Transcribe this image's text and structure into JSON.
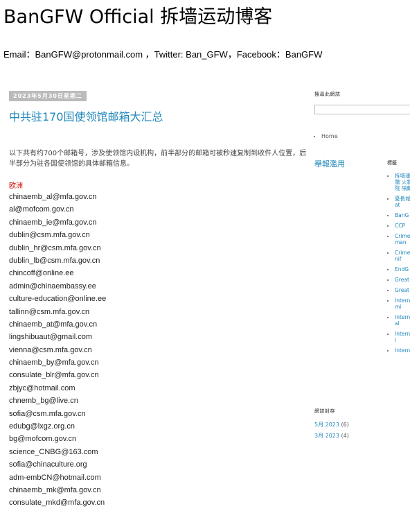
{
  "blog": {
    "title": "BanGFW Official 拆墙运动博客",
    "contact": "Email：BanGFW@protonmail.com ，Twitter: Ban_GFW，Facebook：BanGFW"
  },
  "post": {
    "date": "2023年5月30日星期二",
    "title": "中共驻170国使领馆邮箱大汇总",
    "intro": "以下共有约700个邮箱号，涉及使领馆内设机构，前半部分的邮箱可被秒速复制到收件人位置，后半部分为驻各国使领馆的具体邮箱信息。",
    "region": "欧洲",
    "emails": [
      "chinaemb_al@mfa.gov.cn",
      "al@mofcom.gov.cn",
      "chinaemb_ie@mfa.gov.cn",
      "dublin@csm.mfa.gov.cn",
      "dublin_hr@csm.mfa.gov.cn",
      "dublin_lb@csm.mfa.gov.cn",
      "chincoff@online.ee",
      "admin@chinaembassy.ee",
      "culture-education@online.ee",
      "tallinn@csm.mfa.gov.cn",
      "chinaemb_at@mfa.gov.cn",
      "lingshibuaut@gmail.com",
      "vienna@csm.mfa.gov.cn",
      "chinaemb_by@mfa.gov.cn",
      "consulate_blr@mfa.gov.cn",
      "zbjyc@hotmail.com",
      "chnemb_bg@live.cn",
      "sofia@csm.mfa.gov.cn",
      "edubg@lxgz.org.cn",
      "bg@mofcom.gov.cn",
      "science_CNBG@163.com",
      "sofia@chinaculture.org",
      "adm-embCN@hotmail.com",
      "chinaemb_mk@mfa.gov.cn",
      "consulate_mkd@mfa.gov.cn"
    ]
  },
  "sidebar": {
    "search_label": "搜尋此網誌",
    "search_value": "",
    "pages": [
      "Home"
    ],
    "popular_title": "舉報濫用",
    "labels_title": "標籤",
    "labels": [
      "拆墙運動 翻牆 火牆 法院 隔離",
      "憂長城 Great",
      "BanG",
      "CCP",
      "Crime Human",
      "Crime manif",
      "EndG",
      "Great",
      "Great",
      "Intern Crimi",
      "Intern minal",
      "Intern Wall",
      "Intern ll"
    ],
    "archive_title": "網誌封存",
    "archive": [
      {
        "label": "5月 2023",
        "count": "(6)"
      },
      {
        "label": "3月 2023",
        "count": "(4)"
      }
    ]
  }
}
